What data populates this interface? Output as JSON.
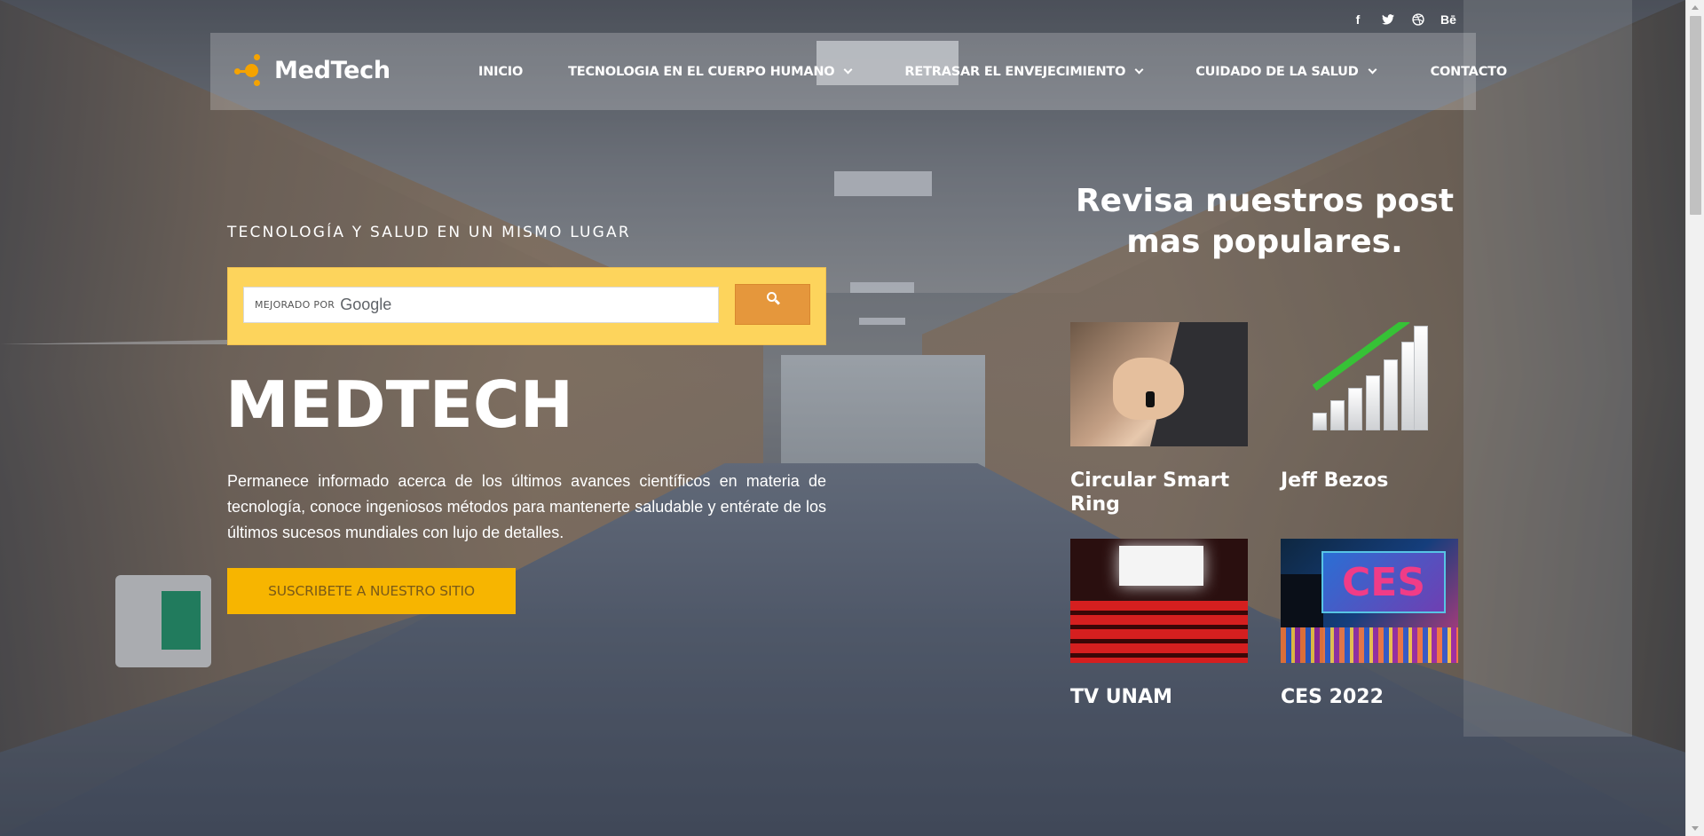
{
  "social": {
    "facebook": "f",
    "twitter": "twitter-bird",
    "dribbble": "dribbble",
    "behance": "Bē"
  },
  "brand": {
    "name": "MedTech",
    "accent": "#f5a300"
  },
  "nav": {
    "items": [
      {
        "label": "INICIO",
        "has_dropdown": false
      },
      {
        "label": "TECNOLOGIA EN EL CUERPO HUMANO",
        "has_dropdown": true
      },
      {
        "label": "RETRASAR EL ENVEJECIMIENTO",
        "has_dropdown": true
      },
      {
        "label": "CUIDADO DE LA SALUD",
        "has_dropdown": true
      },
      {
        "label": "CONTACTO",
        "has_dropdown": false
      }
    ]
  },
  "hero": {
    "tagline": "TECNOLOGÍA Y SALUD EN UN MISMO LUGAR",
    "search": {
      "powered_by": "MEJORADO POR",
      "provider": "Google",
      "button_icon": "search-icon"
    },
    "title": "MEDTECH",
    "description": "Permanece informado acerca de los últimos avances científicos en materia de tecnología, conoce ingeniosos métodos para mantenerte saludable y entérate de los últimos sucesos mundiales con lujo de detalles.",
    "cta_label": "SUSCRIBETE A NUESTRO SITIO"
  },
  "popular": {
    "title": "Revisa nuestros post mas populares.",
    "posts": [
      {
        "title": "Circular Smart Ring"
      },
      {
        "title": "Jeff Bezos"
      },
      {
        "title": "TV UNAM"
      },
      {
        "title": "CES 2022"
      }
    ],
    "ces_sign": "CES"
  },
  "colors": {
    "search_box": "#fdd45c",
    "search_button": "#e5973c",
    "cta_bg": "#f7b500",
    "cta_text": "#7a5a18"
  }
}
